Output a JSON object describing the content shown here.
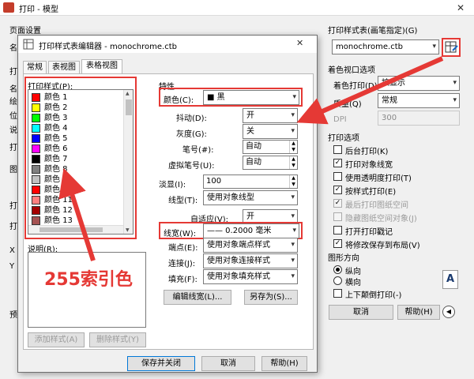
{
  "main": {
    "title": "打印 - 模型",
    "page_setup_label": "页面设置",
    "left_labels": [
      "名",
      "打",
      "名",
      "绘",
      "位",
      "说",
      "打",
      "图",
      "打",
      "打",
      "X",
      "Y",
      "预"
    ],
    "plot_style_table_group": "打印样式表(画笔指定)(G)",
    "plot_style_table_value": "monochrome.ctb",
    "edit_icon_name": "edit-table-icon",
    "shaded_viewport_group": "着色视口选项",
    "shade_plot_label": "着色打印(D)",
    "shade_plot_value": "按显示",
    "quality_label": "质量(Q)",
    "quality_value": "常规",
    "dpi_label": "DPI",
    "dpi_value": "300",
    "plot_options_group": "打印选项",
    "plot_options": [
      {
        "label": "后台打印(K)",
        "checked": false,
        "disabled": false
      },
      {
        "label": "打印对象线宽",
        "checked": true,
        "disabled": false
      },
      {
        "label": "使用透明度打印(T)",
        "checked": false,
        "disabled": false
      },
      {
        "label": "按样式打印(E)",
        "checked": true,
        "disabled": false
      },
      {
        "label": "最后打印图纸空间",
        "checked": true,
        "disabled": true
      },
      {
        "label": "隐藏图纸空间对象(J)",
        "checked": false,
        "disabled": true
      },
      {
        "label": "打开打印戳记",
        "checked": false,
        "disabled": false
      },
      {
        "label": "将修改保存到布局(V)",
        "checked": true,
        "disabled": false
      }
    ],
    "orientation_group": "图形方向",
    "portrait_label": "纵向",
    "landscape_label": "横向",
    "upside_down_label": "上下颠倒打印(-)",
    "orientation_glyph": "A",
    "cancel_label": "取消",
    "help_label": "帮助(H)",
    "back_arrow": "◀"
  },
  "editor": {
    "title": "打印样式表编辑器 - monochrome.ctb",
    "close_glyph": "✕",
    "tabs": [
      "常规",
      "表视图",
      "表格视图"
    ],
    "active_tab": 2,
    "plot_styles_label": "打印样式(P):",
    "styles": [
      {
        "label": "颜色 1",
        "color": "#ff0000"
      },
      {
        "label": "颜色 2",
        "color": "#ffff00"
      },
      {
        "label": "颜色 3",
        "color": "#00ff00"
      },
      {
        "label": "颜色 4",
        "color": "#00ffff"
      },
      {
        "label": "颜色 5",
        "color": "#0000ff"
      },
      {
        "label": "颜色 6",
        "color": "#ff00ff"
      },
      {
        "label": "颜色 7",
        "color": "#000000"
      },
      {
        "label": "颜色 8",
        "color": "#808080"
      },
      {
        "label": "颜色 9",
        "color": "#c0c0c0"
      },
      {
        "label": "颜色 10",
        "color": "#ff0000"
      },
      {
        "label": "颜色 11",
        "color": "#ff7f7f"
      },
      {
        "label": "颜色 12",
        "color": "#a50000"
      },
      {
        "label": "颜色 13",
        "color": "#a55252"
      }
    ],
    "description_label": "说明(R):",
    "add_style_label": "添加样式(A)",
    "delete_style_label": "删除样式(Y)",
    "properties_label": "特性",
    "color_label": "颜色(C):",
    "color_value": "■ 黑",
    "dither_label": "抖动(D):",
    "dither_value": "开",
    "grayscale_label": "灰度(G):",
    "grayscale_value": "关",
    "pen_label": "笔号(#):",
    "pen_value": "自动",
    "virtual_pen_label": "虚拟笔号(U):",
    "virtual_pen_value": "自动",
    "screening_label": "淡显(I):",
    "screening_value": "100",
    "linetype_label": "线型(T):",
    "linetype_value": "使用对象线型",
    "adaptive_label": "自适应(V):",
    "adaptive_value": "开",
    "lineweight_label": "线宽(W):",
    "lineweight_value": "—— 0.2000 毫米",
    "endstyle_label": "端点(E):",
    "endstyle_value": "使用对象端点样式",
    "joinstyle_label": "连接(J):",
    "joinstyle_value": "使用对象连接样式",
    "fillstyle_label": "填充(F):",
    "fillstyle_value": "使用对象填充样式",
    "edit_lineweights_label": "编辑线宽(L)...",
    "save_as_label": "另存为(S)...",
    "save_close_label": "保存并关闭",
    "cancel_label": "取消",
    "help_label": "帮助(H)"
  },
  "annotation": {
    "text": "255索引色",
    "color": "#e53935"
  }
}
